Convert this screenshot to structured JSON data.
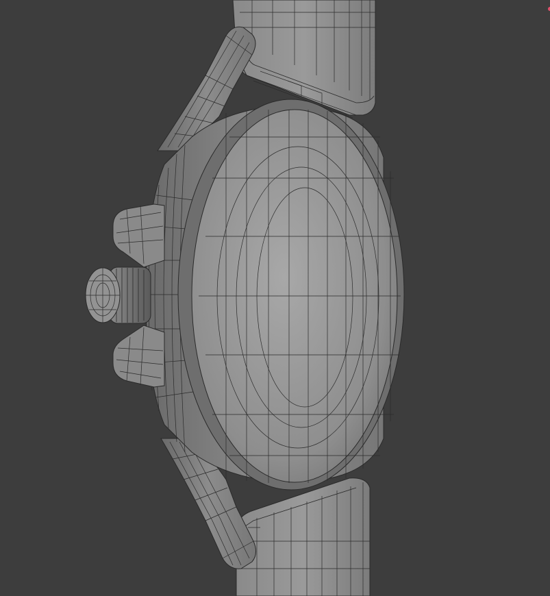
{
  "viewport": {
    "background": "#3d3d3d",
    "mode": "wireframe-overlay",
    "wire_color": "#2a2a2a",
    "mesh_light": "#9d9d9d",
    "mesh_mid": "#7f7f7f",
    "mesh_dark": "#5c5c5c",
    "origin_marker_color": "#e0506a"
  },
  "scene": {
    "object": "wristwatch",
    "view": "side",
    "parts": [
      "strap-top",
      "strap-bottom",
      "lug-top",
      "lug-bottom",
      "case",
      "case-back",
      "crown",
      "crown-guard-top",
      "crown-guard-bottom"
    ]
  }
}
